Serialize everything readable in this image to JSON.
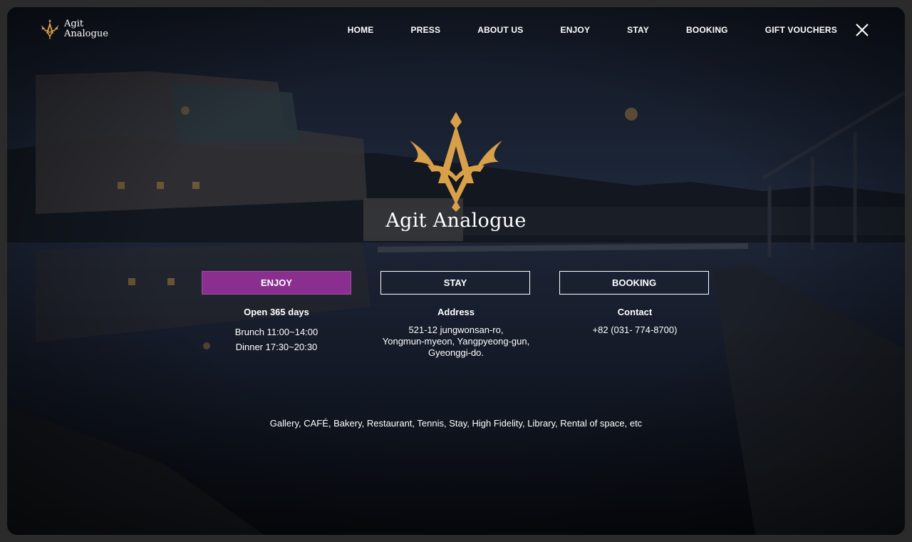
{
  "brand": {
    "line1": "Agit",
    "line2": "Analogue",
    "logo_icon": "av-monogram-icon",
    "color": "#d9a04a"
  },
  "nav": {
    "items": [
      "HOME",
      "PRESS",
      "ABOUT US",
      "ENJOY",
      "STAY",
      "BOOKING",
      "GIFT VOUCHERS"
    ],
    "close_icon": "close-icon"
  },
  "hero": {
    "title": "Agit Analogue"
  },
  "buttons": {
    "enjoy": "ENJOY",
    "stay": "STAY",
    "booking": "BOOKING",
    "accent": "#8a2f8f"
  },
  "info": {
    "hours": {
      "heading": "Open 365 days",
      "lines": [
        "Brunch 11:00~14:00",
        "Dinner 17:30~20:30"
      ]
    },
    "address": {
      "heading": "Address",
      "lines": [
        "521-12 jungwonsan-ro,",
        "Yongmun-myeon, Yangpyeong-gun,",
        "Gyeonggi-do."
      ]
    },
    "contact": {
      "heading": "Contact",
      "lines": [
        "+82 (031- 774-8700)"
      ]
    }
  },
  "tags": "Gallery, CAFÉ, Bakery, Restaurant,  Tennis,  Stay, High Fidelity, Library,  Rental of space, etc"
}
